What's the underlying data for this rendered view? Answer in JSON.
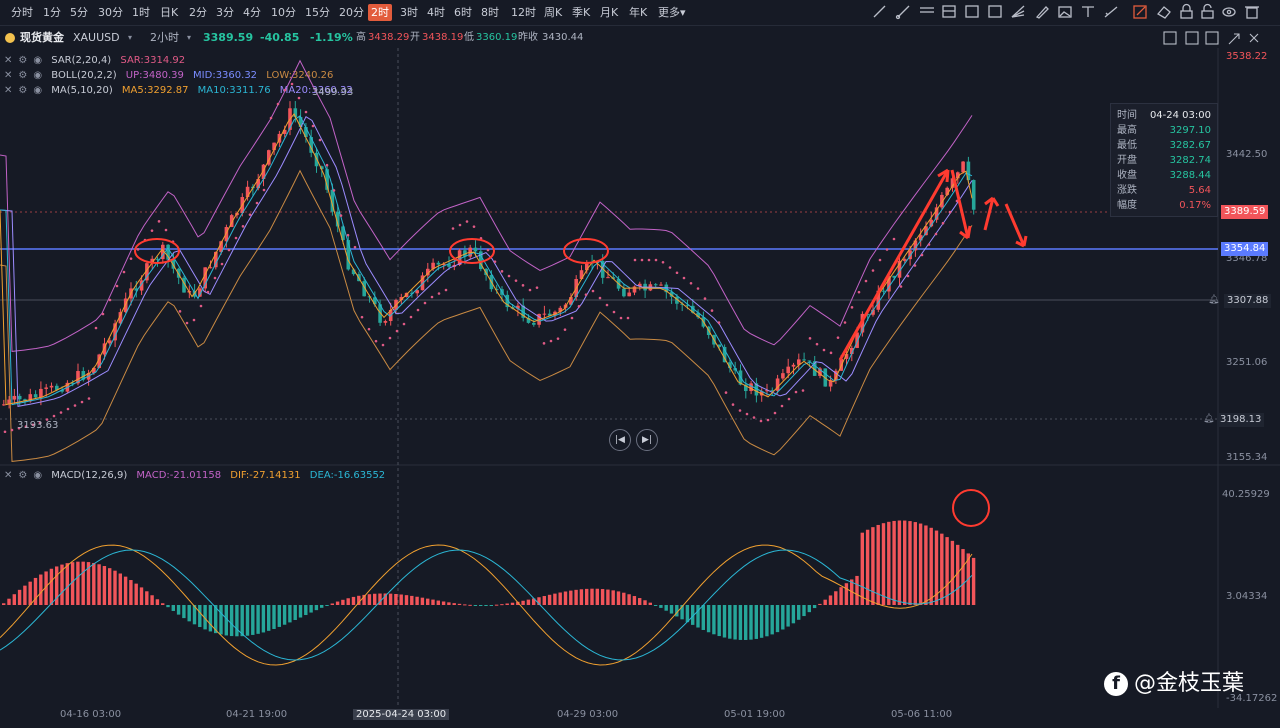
{
  "toolbar": {
    "timeframes": [
      "分时",
      "1分",
      "5分",
      "30分",
      "1时",
      "日K",
      "2分",
      "3分",
      "4分",
      "10分",
      "15分",
      "20分",
      "2时",
      "3时",
      "4时",
      "6时",
      "8时",
      "12时",
      "周K",
      "季K",
      "月K",
      "年K",
      "更多"
    ],
    "active": "2时"
  },
  "header": {
    "name": "现货黄金",
    "symbol": "XAUUSD",
    "period": "2小时",
    "price": "3389.59",
    "change": "-40.85",
    "change_pct": "-1.19%",
    "high_label": "高",
    "high": "3438.29",
    "open_label": "开",
    "open": "3438.19",
    "low_label": "低",
    "low": "3360.19",
    "prev_label": "昨收",
    "prev": "3430.44"
  },
  "indicators": {
    "sar": {
      "name": "SAR(2,20,4)",
      "value": "SAR:3314.92"
    },
    "boll": {
      "name": "BOLL(20,2,2)",
      "up": "UP:3480.39",
      "mid": "MID:3360.32",
      "low": "LOW:3240.26"
    },
    "ma": {
      "name": "MA(5,10,20)",
      "ma5": "MA5:3292.87",
      "ma10": "MA10:3311.76",
      "ma20": "MA20:3360.32"
    },
    "macd": {
      "name": "MACD(12,26,9)",
      "macd": "MACD:-21.01158",
      "dif": "DIF:-27.14131",
      "dea": "DEA:-16.63552"
    }
  },
  "price_axis": [
    "3538.22",
    "3442.50",
    "3346.78",
    "3251.06",
    "3155.34"
  ],
  "price_tags": {
    "current": "3389.59",
    "hline": "3354.84",
    "level1": "3307.88",
    "level2": "3198.13"
  },
  "chart_labels": {
    "peak": "3499.93",
    "trough": "3193.63"
  },
  "macd_axis": [
    "40.25929",
    "3.04334",
    "-34.17262"
  ],
  "x_axis": [
    "04-16 03:00",
    "04-21 19:00",
    "2025-04-24 03:00",
    "04-29 03:00",
    "05-01 19:00",
    "05-06 11:00"
  ],
  "infobox": {
    "rows": [
      {
        "k": "时间",
        "v": "04-24 03:00"
      },
      {
        "k": "最高",
        "v": "3297.10"
      },
      {
        "k": "最低",
        "v": "3282.67"
      },
      {
        "k": "开盘",
        "v": "3282.74"
      },
      {
        "k": "收盘",
        "v": "3288.44"
      },
      {
        "k": "涨跌",
        "v": "5.64"
      },
      {
        "k": "幅度",
        "v": "0.17%"
      }
    ]
  },
  "watermark": "@金枝玉葉",
  "colors": {
    "up": "#f2555a",
    "down": "#26a69a",
    "hline": "#5b7bff",
    "arrow": "#ff3b30",
    "bg": "#161a25"
  }
}
